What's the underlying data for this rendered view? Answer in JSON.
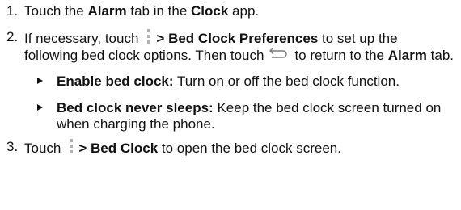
{
  "steps": [
    {
      "num": "1.",
      "t1": "Touch the ",
      "b1": "Alarm",
      "t2": " tab in the ",
      "b2": "Clock",
      "t3": " app."
    },
    {
      "num": "2.",
      "t1": "If necessary, touch",
      "b1": "> Bed Clock Preferences",
      "t2": " to set up the following bed clock options. Then touch",
      "t3": "to return to the ",
      "b2": "Alarm",
      "t4": " tab."
    },
    {
      "num": "3.",
      "t1": "Touch",
      "b1": "> Bed Clock",
      "t2": " to open the bed clock screen."
    }
  ],
  "options": [
    {
      "term": "Enable bed clock:",
      "desc": " Turn on or off the bed clock function."
    },
    {
      "term": "Bed clock never sleeps:",
      "desc": " Keep the bed clock screen turned on when charging the phone."
    }
  ],
  "icons": {
    "menu": "menu-dots-icon",
    "back": "back-arrow-icon",
    "bullet": "triangle-bullet-icon"
  },
  "colors": {
    "text": "#111111",
    "icon": "#b0b0b0"
  }
}
